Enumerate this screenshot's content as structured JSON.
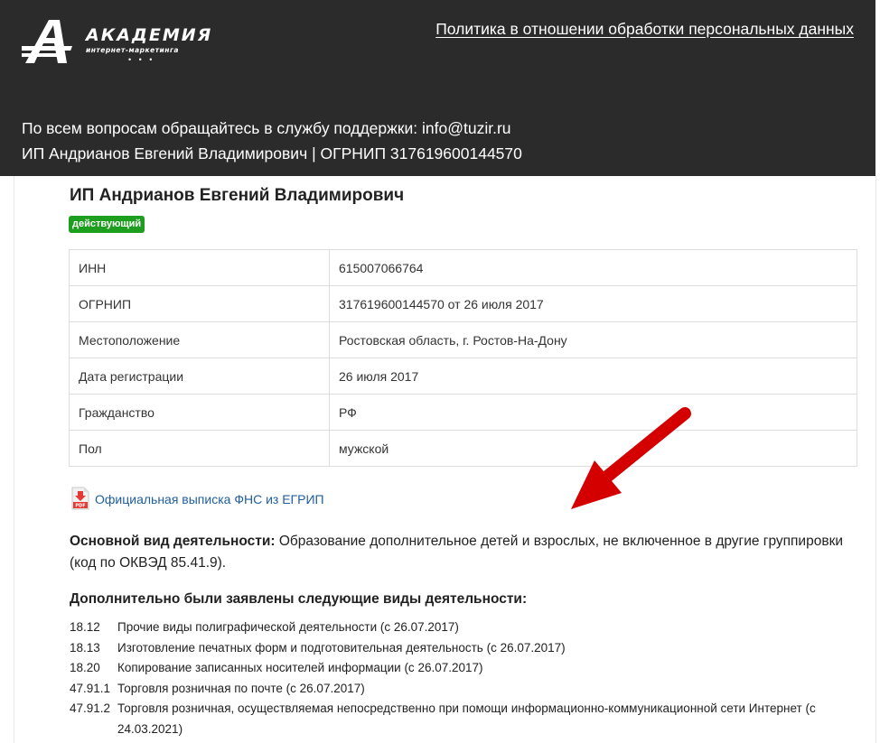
{
  "header": {
    "logo": {
      "title": "АКАДЕМИЯ",
      "subtitle": "интернет-маркетинга",
      "dots": "• • •"
    },
    "policy_link": "Политика в отношении обработки персональных данных",
    "support_line1": "По всем вопросам обращайтесь в службу поддержки: info@tuzir.ru",
    "support_line2": "ИП Андрианов Евгений Владимирович | ОГРНИП 317619600144570"
  },
  "company": {
    "name": "ИП Андрианов Евгений Владимирович",
    "status": "действующий",
    "status_color": "#1e9e1e"
  },
  "info_table": [
    {
      "label": "ИНН",
      "value": "615007066764"
    },
    {
      "label": "ОГРНИП",
      "value": "317619600144570 от 26 июля 2017"
    },
    {
      "label": "Местоположение",
      "value": "Ростовская область, г. Ростов-На-Дону"
    },
    {
      "label": "Дата регистрации",
      "value": "26 июля 2017"
    },
    {
      "label": "Гражданство",
      "value": "РФ"
    },
    {
      "label": "Пол",
      "value": "мужской"
    }
  ],
  "pdf": {
    "icon": "pdf-file-icon",
    "link": "Официальная выписка ФНС из ЕГРИП"
  },
  "main_activity": {
    "label": "Основной вид деятельности:",
    "text": "Образование дополнительное детей и взрослых, не включенное в другие группировки (код по ОКВЭД 85.41.9)."
  },
  "additional": {
    "heading": "Дополнительно были заявлены следующие виды деятельности:",
    "items": [
      {
        "code": "18.12",
        "text": "Прочие виды полиграфической деятельности (с 26.07.2017)"
      },
      {
        "code": "18.13",
        "text": "Изготовление печатных форм и подготовительная деятельность (с 26.07.2017)"
      },
      {
        "code": "18.20",
        "text": "Копирование записанных носителей информации (с 26.07.2017)"
      },
      {
        "code": "47.91.1",
        "text": "Торговля розничная по почте (с 26.07.2017)"
      },
      {
        "code": "47.91.2",
        "text": "Торговля розничная, осуществляемая непосредственно при помощи информационно-коммуникационной сети Интернет (с 24.03.2021)"
      }
    ]
  },
  "annotation": {
    "arrow_color": "#d40000"
  }
}
